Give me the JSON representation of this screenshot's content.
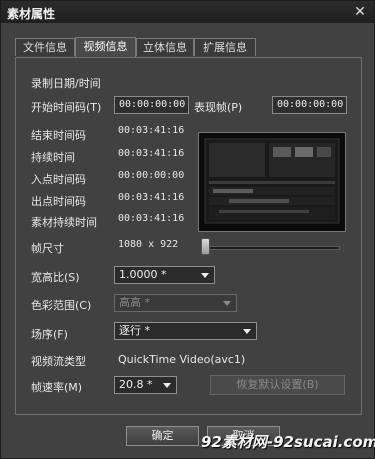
{
  "window": {
    "title": "素材属性",
    "close_glyph": "✕"
  },
  "tabs": [
    {
      "label": "文件信息",
      "active": false
    },
    {
      "label": "视频信息",
      "active": true
    },
    {
      "label": "立体信息",
      "active": false
    },
    {
      "label": "扩展信息",
      "active": false
    }
  ],
  "video": {
    "record_datetime_label": "录制日期/时间",
    "start_tc_label": "开始时间码(T)",
    "start_tc_value": "00:00:00:00",
    "display_frame_label": "表现帧(P)",
    "display_frame_value": "00:00:00:00",
    "end_tc_label": "结束时间码",
    "end_tc_value": "00:03:41:16",
    "duration_label": "持续时间",
    "duration_value": "00:03:41:16",
    "in_point_label": "入点时间码",
    "in_point_value": "00:00:00:00",
    "out_point_label": "出点时间码",
    "out_point_value": "00:03:41:16",
    "clip_duration_label": "素材持续时间",
    "clip_duration_value": "00:03:41:16",
    "frame_size_label": "帧尺寸",
    "frame_size_value": "1080 x 922",
    "aspect_label": "宽高比(S)",
    "aspect_value": "1.0000 *",
    "color_range_label": "色彩范围(C)",
    "color_range_value": "高高 *",
    "field_order_label": "场序(F)",
    "field_order_value": "逐行 *",
    "stream_type_label": "视频流类型",
    "stream_type_value": "QuickTime Video(avc1)",
    "frame_rate_label": "帧速率(M)",
    "frame_rate_value": "20.8 *",
    "restore_defaults_label": "恢复默认设置(B)"
  },
  "footer": {
    "ok_label": "确定",
    "cancel_label": "取消"
  },
  "watermark": "92素材网-92sucai.com"
}
